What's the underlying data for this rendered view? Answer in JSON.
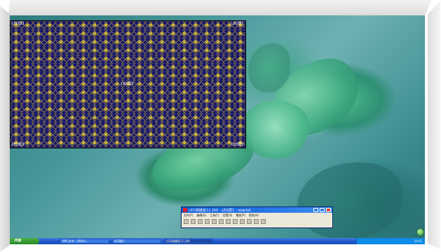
{
  "led_window": {
    "corner_top_left": "LED屏1",
    "corner_top_right": "LED屏1",
    "center": "LED屏1",
    "corner_bottom_left": "LED屏1",
    "corner_bottom_right": "LED屏1",
    "pattern_colors": {
      "background": "#1a1a6b",
      "motif": "#c8b13a"
    }
  },
  "app_window": {
    "title": "LED演播室12.200 - LED屏1 - new.txt",
    "menu": [
      "文件(F)",
      "编辑(E)",
      "工具(T)",
      "设置(S)",
      "播放(P)",
      "帮助(H)"
    ]
  },
  "taskbar": {
    "start_label": "开始",
    "tasks": [
      "RPS 文字 - [RIGO...",
      "LED屏1",
      "LED演播室12.200"
    ],
    "clock": "10:51"
  },
  "colors": {
    "taskbar": "#1c55c4",
    "start": "#2a8a28",
    "titlebar": "#0a5bd6"
  }
}
